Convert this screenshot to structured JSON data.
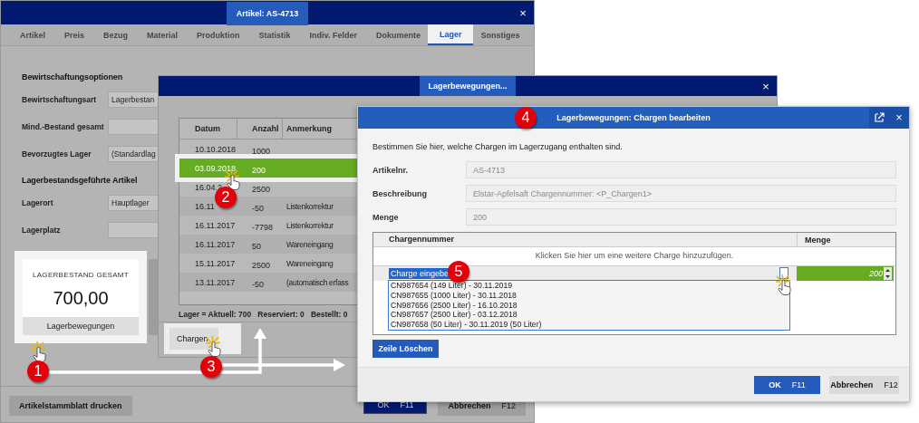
{
  "main_window": {
    "title": "Artikel: AS-4713",
    "close": "×",
    "tabs": [
      {
        "label": "Artikel",
        "selected": false
      },
      {
        "label": "Preis",
        "selected": false
      },
      {
        "label": "Bezug",
        "selected": false
      },
      {
        "label": "Material",
        "selected": false
      },
      {
        "label": "Produktion",
        "selected": false
      },
      {
        "label": "Statistik",
        "selected": false
      },
      {
        "label": "Indiv. Felder",
        "selected": false
      },
      {
        "label": "Dokumente",
        "selected": false
      },
      {
        "label": "Lager",
        "selected": true
      },
      {
        "label": "Sonstiges",
        "selected": false
      }
    ],
    "sections": [
      {
        "heading": "Bewirtschaftungsoptionen",
        "fields": [
          {
            "label": "Bewirtschaftungsart",
            "value": "Lagerbestan"
          },
          {
            "label": "Mind.-Bestand gesamt"
          },
          {
            "label": "Bevorzugtes Lager",
            "value": "(Standardlag"
          }
        ]
      },
      {
        "heading": "Lagerbestandsgeführte Artikel",
        "fields": [
          {
            "label": "Lagerort",
            "value": "Hauptlager"
          },
          {
            "label": "Lagerplatz"
          }
        ]
      }
    ],
    "stock_card": {
      "title": "LAGERBESTAND GESAMT",
      "value": "700,00",
      "button": "Lagerbewegungen"
    },
    "print_button": "Artikelstammblatt drucken",
    "ok_button": {
      "label": "OK",
      "key": "F11"
    },
    "cancel_button": {
      "label": "Abbrechen",
      "key": "F12"
    }
  },
  "movements_dialog": {
    "title": "Lagerbewegungen...",
    "close": "×",
    "columns": [
      "Datum",
      "Anzahl",
      "Anmerkung"
    ],
    "rows": [
      {
        "date": "10.10.2018",
        "quantity": "1000",
        "selected": false
      },
      {
        "date": "03.09.2018",
        "quantity": "200",
        "selected": true
      },
      {
        "date": "16.04.2",
        "quantity": "2500",
        "selected": false
      },
      {
        "date": "16.11",
        "quantity": "-50",
        "note": "Listenkorrektur",
        "selected": false
      },
      {
        "date": "16.11.2017",
        "quantity": "-7798",
        "note": "Listenkorrektur",
        "selected": false
      },
      {
        "date": "16.11.2017",
        "quantity": "50",
        "note": "Wareneingang",
        "selected": false
      },
      {
        "date": "15.11.2017",
        "quantity": "2500",
        "note": "Wareneingang",
        "selected": false
      },
      {
        "date": "13.11.2017",
        "quantity": "-50",
        "note": "(automatisch erfass",
        "selected": false
      }
    ],
    "summary": "Lager = Aktuell: 700   Reserviert: 0   Bestellt: 0",
    "chargen_button": "Chargen"
  },
  "batch_dialog": {
    "title": "Lagerbewegungen: Chargen bearbeiten",
    "close": "×",
    "intro": "Bestimmen Sie hier, welche Chargen im Lagerzugang enthalten sind.",
    "fields": [
      {
        "label": "Artikelnr.",
        "value": "AS-4713",
        "disabled": true
      },
      {
        "label": "Beschreibung",
        "value": "Elstar-Apfelsaft Chargennummer: <P_Chargen1>",
        "disabled": true
      },
      {
        "label": "Menge",
        "value": "200",
        "disabled": true
      }
    ],
    "grid": {
      "columns": [
        "Chargennummer",
        "Menge"
      ],
      "add_hint": "Klicken Sie hier um eine weitere Charge hinzuzufügen.",
      "edit_row": {
        "batch": "Charge eingebe",
        "quantity": "200"
      },
      "options": [
        "CN987654 (149 Liter) - 30.11.2019",
        "CN987655 (1000 Liter) - 30.11.2018",
        "CN987656 (2500 Liter) - 16.10.2018",
        "CN987657 (2500 Liter) - 03.12.2018",
        "CN987658 (50 Liter) - 30.11.2019 (50 Liter)"
      ]
    },
    "delete_button": "Zeile Löschen",
    "ok_button": {
      "label": "OK",
      "key": "F11"
    },
    "cancel_button": {
      "label": "Abbrechen",
      "key": "F12"
    }
  },
  "step_markers": [
    "1",
    "2",
    "3",
    "4",
    "5"
  ]
}
